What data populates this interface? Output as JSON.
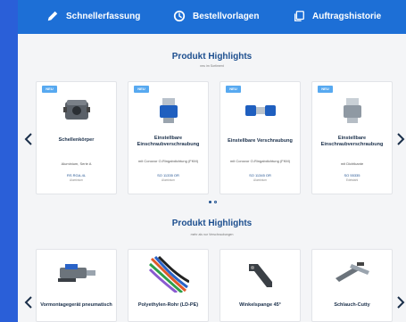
{
  "nav": {
    "items": [
      {
        "label": "Schnellerfassung",
        "icon": "pencil-icon"
      },
      {
        "label": "Bestellvorlagen",
        "icon": "clock-icon"
      },
      {
        "label": "Auftragshistorie",
        "icon": "copy-icon"
      }
    ]
  },
  "sections": [
    {
      "title": "Produkt Highlights",
      "subtitle": "neu im Sortiment",
      "cards": [
        {
          "badge": "NEU",
          "name": "Schellenkörper",
          "desc": "Aluminium, Serie A",
          "art": "RS RGA-4L",
          "mat": "Aluminium"
        },
        {
          "badge": "NEU",
          "name": "Einstellbare Einschraubverschraubung",
          "desc": "mit Conovor O-Ringabdichtung (FKM)",
          "art": "SO 11335 OR",
          "mat": "Aluminium"
        },
        {
          "badge": "NEU",
          "name": "Einstellbare Verschraubung",
          "desc": "mit Conovor O-Ringabdichtung (FKM)",
          "art": "SO 11345 OR",
          "mat": "Aluminium"
        },
        {
          "badge": "NEU",
          "name": "Einstellbare Einschraubverschraubung",
          "desc": "mit Dichtkante",
          "art": "SO 55335",
          "mat": "Edelstahl"
        }
      ]
    },
    {
      "title": "Produkt Highlights",
      "subtitle": "mehr als nur Verschraubungen",
      "cards": [
        {
          "name": "Vormontagegerät pneumatisch"
        },
        {
          "name": "Polyethylen-Rohr (LD-PE)"
        },
        {
          "name": "Winkelspange 45°"
        },
        {
          "name": "Schlauch-Cutty"
        }
      ]
    }
  ],
  "carousel": {
    "active_page": 1,
    "page_count": 2
  },
  "colors": {
    "topbar": "#1d6fd6",
    "title": "#1d4f8f",
    "badge": "#57a9f0"
  }
}
